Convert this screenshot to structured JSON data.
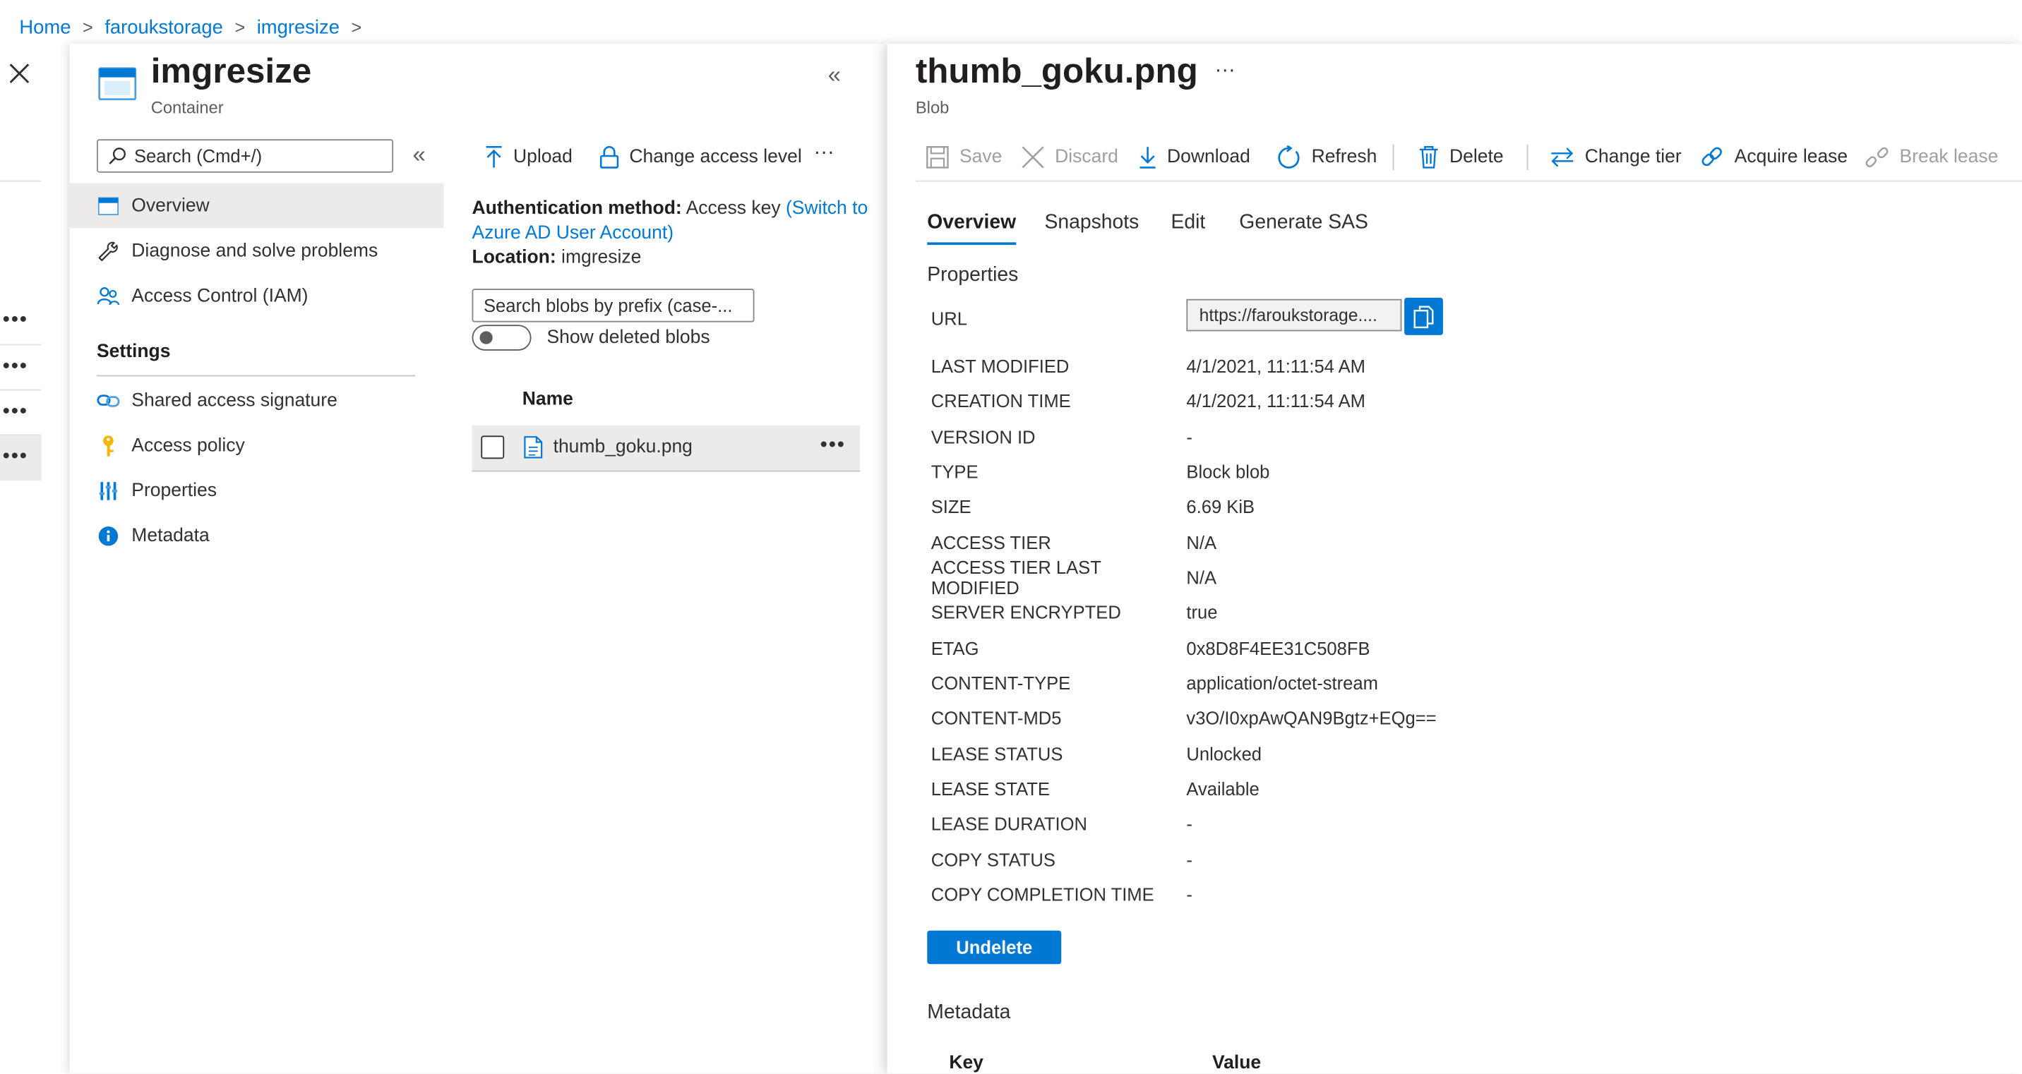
{
  "breadcrumb": {
    "items": [
      "Home",
      "faroukstorage",
      "imgresize"
    ]
  },
  "container": {
    "title": "imgresize",
    "subtitle": "Container",
    "search_placeholder": "Search (Cmd+/)",
    "nav": {
      "overview": "Overview",
      "diagnose": "Diagnose and solve problems",
      "iam": "Access Control (IAM)",
      "settings_heading": "Settings",
      "sas": "Shared access signature",
      "access_policy": "Access policy",
      "properties": "Properties",
      "metadata": "Metadata"
    },
    "toolbar": {
      "upload": "Upload",
      "change_access": "Change access level",
      "more": "···"
    },
    "auth": {
      "label": "Authentication method:",
      "value": "Access key",
      "switch_link": "(Switch to Azure AD User Account)",
      "location_label": "Location:",
      "location_value": "imgresize"
    },
    "blob_search_placeholder": "Search blobs by prefix (case-...",
    "show_deleted_label": "Show deleted blobs",
    "list": {
      "column_name": "Name",
      "rows": [
        {
          "name": "thumb_goku.png"
        }
      ]
    }
  },
  "blob": {
    "title": "thumb_goku.png",
    "subtitle": "Blob",
    "more": "···",
    "toolbar": {
      "save": "Save",
      "discard": "Discard",
      "download": "Download",
      "refresh": "Refresh",
      "delete": "Delete",
      "change_tier": "Change tier",
      "acquire_lease": "Acquire lease",
      "break_lease": "Break lease"
    },
    "tabs": [
      "Overview",
      "Snapshots",
      "Edit",
      "Generate SAS"
    ],
    "properties_heading": "Properties",
    "url_label": "URL",
    "url_value": "https://faroukstorage....",
    "properties": [
      {
        "key": "LAST MODIFIED",
        "value": "4/1/2021, 11:11:54 AM"
      },
      {
        "key": "CREATION TIME",
        "value": "4/1/2021, 11:11:54 AM"
      },
      {
        "key": "VERSION ID",
        "value": "-"
      },
      {
        "key": "TYPE",
        "value": "Block blob"
      },
      {
        "key": "SIZE",
        "value": "6.69 KiB"
      },
      {
        "key": "ACCESS TIER",
        "value": "N/A"
      },
      {
        "key": "ACCESS TIER LAST MODIFIED",
        "value": "N/A"
      },
      {
        "key": "SERVER ENCRYPTED",
        "value": "true"
      },
      {
        "key": "ETAG",
        "value": "0x8D8F4EE31C508FB"
      },
      {
        "key": "CONTENT-TYPE",
        "value": "application/octet-stream"
      },
      {
        "key": "CONTENT-MD5",
        "value": "v3O/I0xpAwQAN9Bgtz+EQg=="
      },
      {
        "key": "LEASE STATUS",
        "value": "Unlocked"
      },
      {
        "key": "LEASE STATE",
        "value": "Available"
      },
      {
        "key": "LEASE DURATION",
        "value": "-"
      },
      {
        "key": "COPY STATUS",
        "value": "-"
      },
      {
        "key": "COPY COMPLETION TIME",
        "value": "-"
      }
    ],
    "undelete_label": "Undelete",
    "metadata_heading": "Metadata",
    "metadata_columns": {
      "key": "Key",
      "value": "Value"
    }
  },
  "colors": {
    "accent": "#0078d4",
    "text": "#323130",
    "muted": "#605e5c",
    "selected_row": "#edebe9"
  }
}
